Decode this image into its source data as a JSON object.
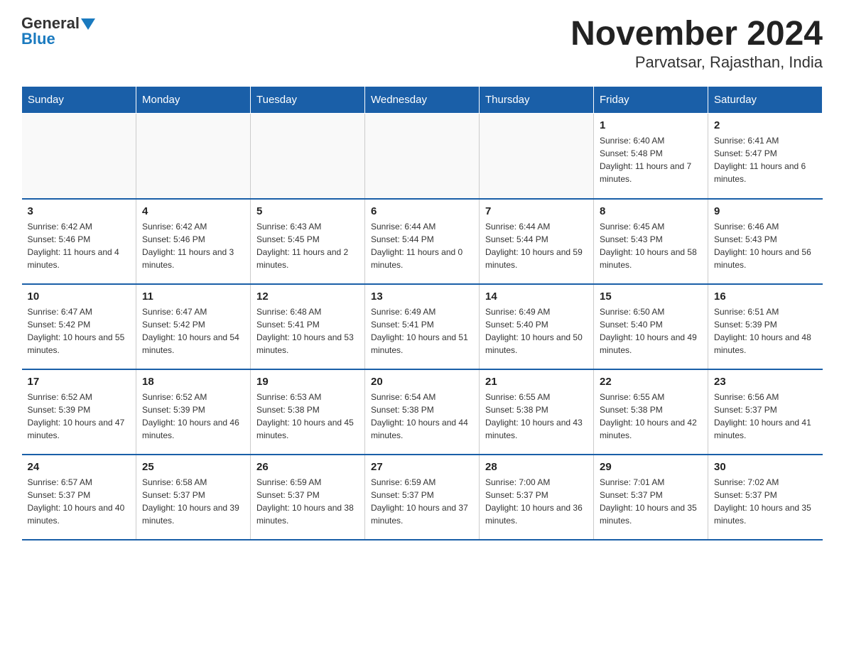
{
  "header": {
    "logo_general": "General",
    "logo_blue": "Blue",
    "title": "November 2024",
    "subtitle": "Parvatsar, Rajasthan, India"
  },
  "days_of_week": [
    "Sunday",
    "Monday",
    "Tuesday",
    "Wednesday",
    "Thursday",
    "Friday",
    "Saturday"
  ],
  "weeks": [
    {
      "days": [
        {
          "num": "",
          "info": ""
        },
        {
          "num": "",
          "info": ""
        },
        {
          "num": "",
          "info": ""
        },
        {
          "num": "",
          "info": ""
        },
        {
          "num": "",
          "info": ""
        },
        {
          "num": "1",
          "info": "Sunrise: 6:40 AM\nSunset: 5:48 PM\nDaylight: 11 hours and 7 minutes."
        },
        {
          "num": "2",
          "info": "Sunrise: 6:41 AM\nSunset: 5:47 PM\nDaylight: 11 hours and 6 minutes."
        }
      ]
    },
    {
      "days": [
        {
          "num": "3",
          "info": "Sunrise: 6:42 AM\nSunset: 5:46 PM\nDaylight: 11 hours and 4 minutes."
        },
        {
          "num": "4",
          "info": "Sunrise: 6:42 AM\nSunset: 5:46 PM\nDaylight: 11 hours and 3 minutes."
        },
        {
          "num": "5",
          "info": "Sunrise: 6:43 AM\nSunset: 5:45 PM\nDaylight: 11 hours and 2 minutes."
        },
        {
          "num": "6",
          "info": "Sunrise: 6:44 AM\nSunset: 5:44 PM\nDaylight: 11 hours and 0 minutes."
        },
        {
          "num": "7",
          "info": "Sunrise: 6:44 AM\nSunset: 5:44 PM\nDaylight: 10 hours and 59 minutes."
        },
        {
          "num": "8",
          "info": "Sunrise: 6:45 AM\nSunset: 5:43 PM\nDaylight: 10 hours and 58 minutes."
        },
        {
          "num": "9",
          "info": "Sunrise: 6:46 AM\nSunset: 5:43 PM\nDaylight: 10 hours and 56 minutes."
        }
      ]
    },
    {
      "days": [
        {
          "num": "10",
          "info": "Sunrise: 6:47 AM\nSunset: 5:42 PM\nDaylight: 10 hours and 55 minutes."
        },
        {
          "num": "11",
          "info": "Sunrise: 6:47 AM\nSunset: 5:42 PM\nDaylight: 10 hours and 54 minutes."
        },
        {
          "num": "12",
          "info": "Sunrise: 6:48 AM\nSunset: 5:41 PM\nDaylight: 10 hours and 53 minutes."
        },
        {
          "num": "13",
          "info": "Sunrise: 6:49 AM\nSunset: 5:41 PM\nDaylight: 10 hours and 51 minutes."
        },
        {
          "num": "14",
          "info": "Sunrise: 6:49 AM\nSunset: 5:40 PM\nDaylight: 10 hours and 50 minutes."
        },
        {
          "num": "15",
          "info": "Sunrise: 6:50 AM\nSunset: 5:40 PM\nDaylight: 10 hours and 49 minutes."
        },
        {
          "num": "16",
          "info": "Sunrise: 6:51 AM\nSunset: 5:39 PM\nDaylight: 10 hours and 48 minutes."
        }
      ]
    },
    {
      "days": [
        {
          "num": "17",
          "info": "Sunrise: 6:52 AM\nSunset: 5:39 PM\nDaylight: 10 hours and 47 minutes."
        },
        {
          "num": "18",
          "info": "Sunrise: 6:52 AM\nSunset: 5:39 PM\nDaylight: 10 hours and 46 minutes."
        },
        {
          "num": "19",
          "info": "Sunrise: 6:53 AM\nSunset: 5:38 PM\nDaylight: 10 hours and 45 minutes."
        },
        {
          "num": "20",
          "info": "Sunrise: 6:54 AM\nSunset: 5:38 PM\nDaylight: 10 hours and 44 minutes."
        },
        {
          "num": "21",
          "info": "Sunrise: 6:55 AM\nSunset: 5:38 PM\nDaylight: 10 hours and 43 minutes."
        },
        {
          "num": "22",
          "info": "Sunrise: 6:55 AM\nSunset: 5:38 PM\nDaylight: 10 hours and 42 minutes."
        },
        {
          "num": "23",
          "info": "Sunrise: 6:56 AM\nSunset: 5:37 PM\nDaylight: 10 hours and 41 minutes."
        }
      ]
    },
    {
      "days": [
        {
          "num": "24",
          "info": "Sunrise: 6:57 AM\nSunset: 5:37 PM\nDaylight: 10 hours and 40 minutes."
        },
        {
          "num": "25",
          "info": "Sunrise: 6:58 AM\nSunset: 5:37 PM\nDaylight: 10 hours and 39 minutes."
        },
        {
          "num": "26",
          "info": "Sunrise: 6:59 AM\nSunset: 5:37 PM\nDaylight: 10 hours and 38 minutes."
        },
        {
          "num": "27",
          "info": "Sunrise: 6:59 AM\nSunset: 5:37 PM\nDaylight: 10 hours and 37 minutes."
        },
        {
          "num": "28",
          "info": "Sunrise: 7:00 AM\nSunset: 5:37 PM\nDaylight: 10 hours and 36 minutes."
        },
        {
          "num": "29",
          "info": "Sunrise: 7:01 AM\nSunset: 5:37 PM\nDaylight: 10 hours and 35 minutes."
        },
        {
          "num": "30",
          "info": "Sunrise: 7:02 AM\nSunset: 5:37 PM\nDaylight: 10 hours and 35 minutes."
        }
      ]
    }
  ]
}
